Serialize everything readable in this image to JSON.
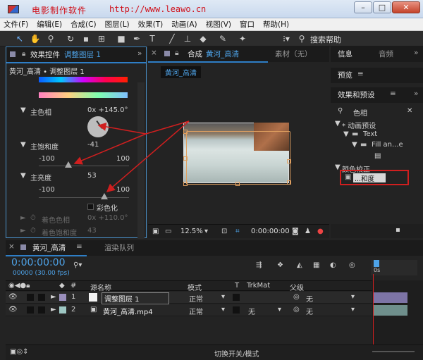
{
  "titlebar": {
    "watermark_text": "电影制作软件",
    "watermark_url": "http://www.leawo.cn",
    "minimize": "–",
    "maximize": "□",
    "close": "✕"
  },
  "menu": [
    "文件(F)",
    "编辑(E)",
    "合成(C)",
    "图层(L)",
    "效果(T)",
    "动画(A)",
    "视图(V)",
    "窗口",
    "帮助(H)"
  ],
  "toolbar": {
    "search_help": "搜索帮助"
  },
  "effect_controls": {
    "tab_label": "效果控件",
    "tab_layer": "调整图层 1",
    "breadcrumb": "黄河_高清 • 调整图层 1",
    "props": {
      "hue": {
        "label": "主色相",
        "value": "0x +145.0°"
      },
      "saturation": {
        "label": "主饱和度",
        "value": "-41",
        "min": "-100",
        "max": "100"
      },
      "lightness": {
        "label": "主亮度",
        "value": "53",
        "min": "-100",
        "max": "100"
      },
      "colorize": {
        "label": "彩色化"
      },
      "colorize_hue": {
        "label": "着色色相",
        "value": "0x +110.0°"
      },
      "colorize_sat": {
        "label": "着色饱和度",
        "value": "43"
      }
    }
  },
  "composition": {
    "tab_prefix": "合成",
    "tab_name": "黄河_高清",
    "other_tab": "素材（无）",
    "comp_label": "黄河_高清",
    "zoom": "12.5%",
    "time": "0:00:00:00"
  },
  "right_panels": {
    "info_tab": "信息",
    "audio_tab": "音频",
    "preview_tab": "预览",
    "effects_tab": "效果和预设",
    "search_value": "色相",
    "tree": [
      {
        "label": "* 动画预设",
        "level": 0
      },
      {
        "label": "Text",
        "level": 1
      },
      {
        "label": "Fill an...e",
        "level": 2
      },
      {
        "label": "",
        "level": 3
      },
      {
        "label": "颜色校正",
        "level": 0
      },
      {
        "label": "...和度",
        "level": 1
      }
    ]
  },
  "timeline": {
    "tab_name": "黄河_高清",
    "render_queue": "渲染队列",
    "time": "0:00:00:00",
    "fps": "00000 (30.00 fps)",
    "search_placeholder": "",
    "columns": {
      "source_name": "源名称",
      "mode": "模式",
      "t": "T",
      "trkmat": "TrkMat",
      "parent": "父级"
    },
    "layers": [
      {
        "index": "1",
        "name": "调整图层 1",
        "mode": "正常",
        "trkmat": "",
        "parent": "无"
      },
      {
        "index": "2",
        "name": "黄河_高清.mp4",
        "mode": "正常",
        "trkmat": "无",
        "parent": "无"
      }
    ],
    "ruler_label": "0s",
    "footer": "切换开关/模式"
  }
}
